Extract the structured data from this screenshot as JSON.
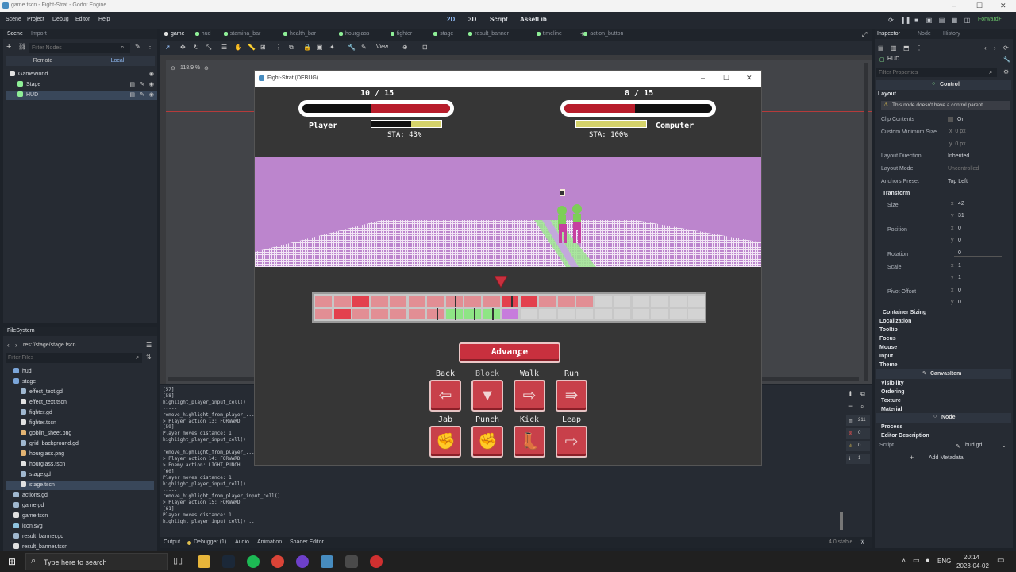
{
  "window": {
    "title": "game.tscn - Fight-Strat - Godot Engine",
    "controls": [
      "–",
      "☐",
      "✕"
    ]
  },
  "menus": [
    "Scene",
    "Project",
    "Debug",
    "Editor",
    "Help"
  ],
  "modes": [
    "2D",
    "3D",
    "Script",
    "AssetLib"
  ],
  "renderer": "Forward+",
  "scene_dock": {
    "tabs": [
      "Scene",
      "Import"
    ],
    "filter_placeholder": "Filter Nodes",
    "remote": "Remote",
    "local": "Local",
    "nodes": [
      {
        "label": "GameWorld",
        "color": "#e1e1e1"
      },
      {
        "label": "Stage",
        "color": "#8eef97"
      },
      {
        "label": "HUD",
        "color": "#8eef97"
      }
    ]
  },
  "filesystem": {
    "tab": "FileSystem",
    "path": "res://stage/stage.tscn",
    "filter_placeholder": "Filter Files",
    "items": [
      {
        "label": "hud",
        "type": "folder",
        "indent": 1
      },
      {
        "label": "stage",
        "type": "folder",
        "indent": 1
      },
      {
        "label": "effect_text.gd",
        "type": "gd",
        "indent": 2
      },
      {
        "label": "effect_text.tscn",
        "type": "tscn",
        "indent": 2
      },
      {
        "label": "fighter.gd",
        "type": "gd",
        "indent": 2
      },
      {
        "label": "fighter.tscn",
        "type": "tscn",
        "indent": 2
      },
      {
        "label": "goblin_sheet.png",
        "type": "png",
        "indent": 2
      },
      {
        "label": "grid_background.gd",
        "type": "gd",
        "indent": 2
      },
      {
        "label": "hourglass.png",
        "type": "png",
        "indent": 2
      },
      {
        "label": "hourglass.tscn",
        "type": "tscn",
        "indent": 2
      },
      {
        "label": "stage.gd",
        "type": "gd",
        "indent": 2
      },
      {
        "label": "stage.tscn",
        "type": "tscn",
        "indent": 2
      },
      {
        "label": "actions.gd",
        "type": "gd",
        "indent": 1
      },
      {
        "label": "game.gd",
        "type": "gd",
        "indent": 1
      },
      {
        "label": "game.tscn",
        "type": "tscn",
        "indent": 1
      },
      {
        "label": "icon.svg",
        "type": "svg",
        "indent": 1
      },
      {
        "label": "result_banner.gd",
        "type": "gd",
        "indent": 1
      },
      {
        "label": "result_banner.tscn",
        "type": "tscn",
        "indent": 1
      }
    ]
  },
  "doc_tabs": [
    "game",
    "hud",
    "stamina_bar",
    "health_bar",
    "hourglass",
    "fighter",
    "stage",
    "result_banner",
    "timeline",
    "action_button"
  ],
  "zoom": "118.9 %",
  "view_label": "View",
  "output_lines": [
    "[57]",
    "[58]",
    "highlight_player_input_cell()",
    "-----",
    "remove_highlight_from_player_...",
    "> Player action 13: FORWARD",
    "[59]",
    "Player moves distance: 1",
    "highlight_player_input_cell()",
    "-----",
    "remove_highlight_from_player_...",
    "> Player action 14: FORWARD",
    "> Enemy action: LIGHT_PUNCH",
    "[60]",
    "Player moves distance: 1",
    "highlight_player_input_cell() ...",
    "-----",
    "remove_highlight_from_player_input_cell() ...",
    "> Player action 15: FORWARD",
    "[61]",
    "Player moves distance: 1",
    "highlight_player_input_cell() ...",
    "-----"
  ],
  "bottom_tabs": [
    "Output",
    "Debugger (1)",
    "Audio",
    "Animation",
    "Shader Editor"
  ],
  "version": "4.0.stable",
  "counters": [
    "211",
    "0",
    "0",
    "1"
  ],
  "game": {
    "window_title": "Fight-Strat (DEBUG)",
    "player": {
      "name": "Player",
      "hp_text": "10 / 15",
      "hp": 10,
      "hp_max": 15,
      "sta_text": "STA: 43%",
      "sta": 0.43
    },
    "computer": {
      "name": "Computer",
      "hp_text": "8 / 15",
      "hp": 8,
      "hp_max": 15,
      "sta_text": "STA: 100%",
      "sta": 1.0
    },
    "timeline_top": [
      "#e28e94",
      "#e28e94",
      "#e3414e",
      "#e28e94",
      "#e28e94",
      "#e28e94",
      "#e28e94",
      "#e28e94",
      "#e28e94",
      "#e28e94",
      "#e3414e",
      "#e3414e",
      "#e28e94",
      "#e28e94",
      "#e28e94",
      "#d3d3d3",
      "#d3d3d3",
      "#d3d3d3",
      "#d3d3d3",
      "#d3d3d3",
      "#d3d3d3"
    ],
    "timeline_bottom": [
      "#e28e94",
      "#e3414e",
      "#e28e94",
      "#e28e94",
      "#e28e94",
      "#e28e94",
      "#e28e94",
      "#8ee585",
      "#8ee585",
      "#8ee585",
      "#c77bdc",
      "#d3d3d3",
      "#d3d3d3",
      "#d3d3d3",
      "#d3d3d3",
      "#d3d3d3",
      "#d3d3d3",
      "#d3d3d3",
      "#d3d3d3",
      "#d3d3d3",
      "#d3d3d3"
    ],
    "advance_label": "Advance",
    "actions": [
      {
        "label": "Back",
        "icon": "arrow-left-icon",
        "glyph": "⇦"
      },
      {
        "label": "Block",
        "icon": "block-icon",
        "glyph": "▼"
      },
      {
        "label": "Walk",
        "icon": "arrow-right-icon",
        "glyph": "⇨"
      },
      {
        "label": "Run",
        "icon": "run-icon",
        "glyph": "⇛"
      },
      {
        "label": "Jab",
        "icon": "jab-icon",
        "glyph": "✊"
      },
      {
        "label": "Punch",
        "icon": "punch-icon",
        "glyph": "✊"
      },
      {
        "label": "Kick",
        "icon": "kick-icon",
        "glyph": "👢"
      },
      {
        "label": "Leap",
        "icon": "leap-icon",
        "glyph": "⇨"
      }
    ]
  },
  "inspector": {
    "tabs": [
      "Inspector",
      "Node",
      "History"
    ],
    "node": "HUD",
    "filter_placeholder": "Filter Properties",
    "class": "Control",
    "layout_label": "Layout",
    "warning": "This node doesn't have a control parent.",
    "rows": [
      {
        "label": "Clip Contents",
        "value": "On"
      },
      {
        "label": "Custom Minimum Size",
        "value": ""
      },
      {
        "label": "Layout Direction",
        "value": "Inherited"
      },
      {
        "label": "Layout Mode",
        "value": "Uncontrolled"
      },
      {
        "label": "Anchors Preset",
        "value": "Top Left"
      }
    ],
    "transform_label": "Transform",
    "transform": [
      {
        "label": "Size",
        "x": "42",
        "y": "31"
      },
      {
        "label": "Position",
        "x": "0",
        "y": "0"
      },
      {
        "label": "Rotation",
        "x": "0",
        "y": ""
      },
      {
        "label": "Scale",
        "x": "1",
        "y": "1"
      },
      {
        "label": "Pivot Offset",
        "x": "0",
        "y": "0"
      }
    ],
    "sections": [
      "Container Sizing",
      "Localization",
      "Tooltip",
      "Focus",
      "Mouse",
      "Input",
      "Theme"
    ],
    "canvas_item": "CanvasItem",
    "sections2": [
      "Visibility",
      "Ordering",
      "Texture",
      "Material"
    ],
    "node_label": "Node",
    "sections3": [
      "Process",
      "Editor Description"
    ],
    "script_label": "Script",
    "script_value": "hud.gd",
    "add_metadata": "Add Metadata"
  },
  "taskbar": {
    "search": "Type here to search",
    "lang": "ENG",
    "time": "20:14",
    "date": "2023-04-02"
  }
}
